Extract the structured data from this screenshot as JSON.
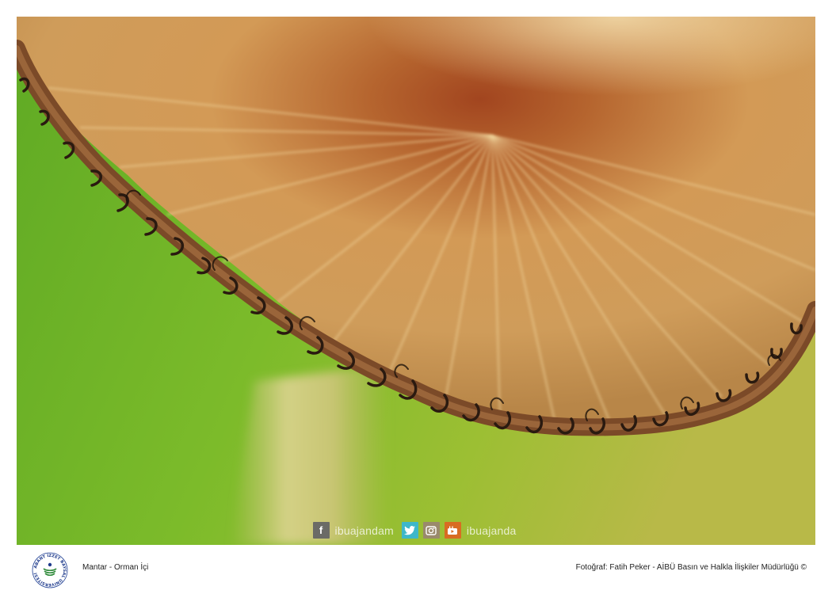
{
  "photo": {
    "subject": "mushroom-cap-macro",
    "colors": {
      "background_green": "#6fb52a",
      "cap_orange": "#c9854a",
      "cap_brown": "#8a4b1f",
      "cap_edge_dark": "#3a2414",
      "stem_cream": "#d9c98c"
    }
  },
  "social": {
    "facebook_icon": "f",
    "twitter_icon": "twitter-bird",
    "instagram_icon": "camera",
    "youtube_icon": "youtube",
    "handle_primary": "ibuajandam",
    "handle_secondary": "ibuajanda"
  },
  "footer": {
    "logo_text": "ABANT İZZET BAYSAL ÜNİVERSİTESİ",
    "caption": "Mantar - Orman İçi",
    "credit": "Fotoğraf: Fatih Peker - AİBÜ Basın ve Halkla İlişkiler Müdürlüğü ©"
  }
}
